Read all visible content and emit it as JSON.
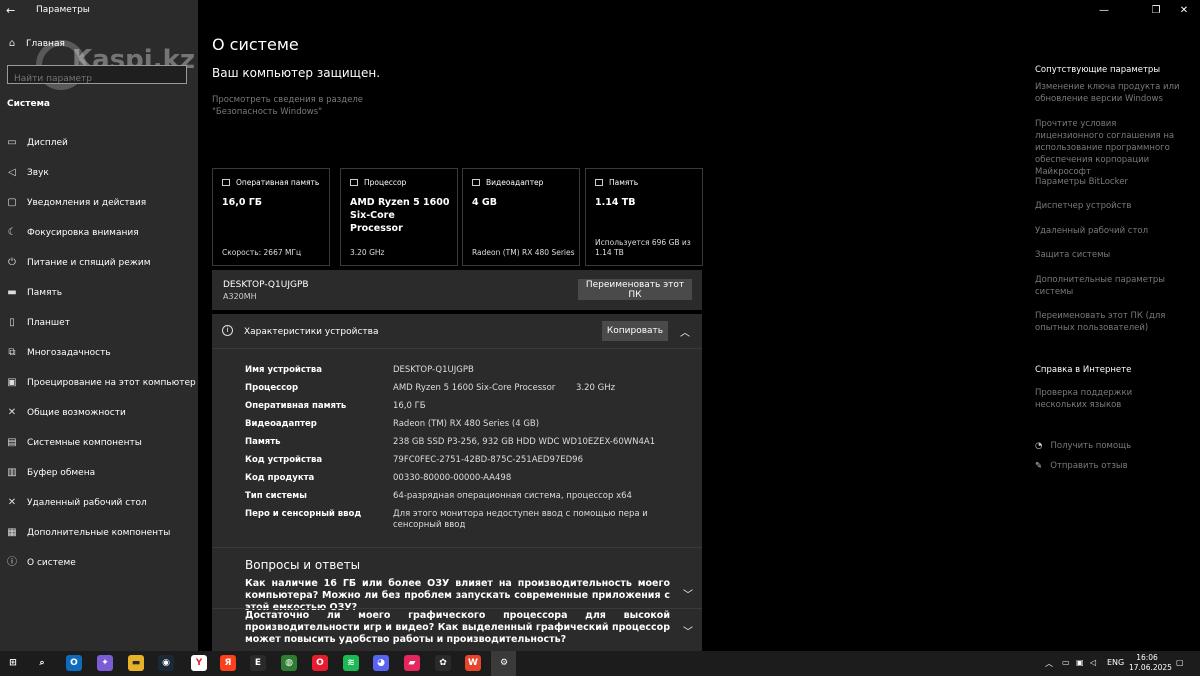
{
  "titlebar": {
    "app_title": "Параметры",
    "back": "←",
    "minimize": "—",
    "maximize": "❐",
    "close": "✕"
  },
  "watermark": "Kaspi.kz",
  "sidebar": {
    "home": "Главная",
    "search_placeholder": "Найти параметр",
    "section": "Система",
    "items": [
      {
        "label": "Дисплей",
        "icon": "display-icon",
        "glyph": "▭"
      },
      {
        "label": "Звук",
        "icon": "speaker-icon",
        "glyph": "◁"
      },
      {
        "label": "Уведомления и действия",
        "icon": "notification-icon",
        "glyph": "▢"
      },
      {
        "label": "Фокусировка внимания",
        "icon": "moon-icon",
        "glyph": "☾"
      },
      {
        "label": "Питание и спящий режим",
        "icon": "power-icon",
        "glyph": "⏻"
      },
      {
        "label": "Память",
        "icon": "storage-icon",
        "glyph": "▬"
      },
      {
        "label": "Планшет",
        "icon": "tablet-icon",
        "glyph": "▯"
      },
      {
        "label": "Многозадачность",
        "icon": "multitask-icon",
        "glyph": "⧉"
      },
      {
        "label": "Проецирование на этот компьютер",
        "icon": "project-icon",
        "glyph": "▣"
      },
      {
        "label": "Общие возможности",
        "icon": "shared-icon",
        "glyph": "✕"
      },
      {
        "label": "Системные компоненты",
        "icon": "components-icon",
        "glyph": "▤"
      },
      {
        "label": "Буфер обмена",
        "icon": "clipboard-icon",
        "glyph": "▥"
      },
      {
        "label": "Удаленный рабочий стол",
        "icon": "remote-icon",
        "glyph": "✕"
      },
      {
        "label": "Дополнительные компоненты",
        "icon": "addons-icon",
        "glyph": "▦"
      },
      {
        "label": "О системе",
        "icon": "info-icon",
        "glyph": "ⓘ"
      }
    ]
  },
  "main": {
    "title": "О системе",
    "protected": "Ваш компьютер защищен.",
    "security_link": "Просмотреть сведения в разделе \"Безопасность Windows\"",
    "cards": [
      {
        "head": "Оперативная память",
        "value": "16,0 ГБ",
        "sub": "Скорость: 2667 МГц"
      },
      {
        "head": "Процессор",
        "value": "AMD Ryzen 5 1600 Six-Core Processor",
        "sub": "3.20 GHz"
      },
      {
        "head": "Видеоадаптер",
        "value": "4 GB",
        "sub": "Radeon (TM) RX 480 Series"
      },
      {
        "head": "Память",
        "value": "1.14 TB",
        "sub": "Используется 696 GB из 1.14 TB"
      }
    ],
    "pc_name": "DESKTOP-Q1UJGPB",
    "board": "A320MH",
    "rename_button": "Переименовать этот ПК",
    "specs_title": "Характеристики устройства",
    "copy_button": "Копировать",
    "specs": [
      {
        "key": "Имя устройства",
        "value": "DESKTOP-Q1UJGPB"
      },
      {
        "key": "Процессор",
        "value": "AMD Ryzen 5 1600 Six-Core Processor",
        "extra": "3.20 GHz"
      },
      {
        "key": "Оперативная память",
        "value": "16,0 ГБ"
      },
      {
        "key": "Видеоадаптер",
        "value": "Radeon (TM) RX 480 Series (4 GB)"
      },
      {
        "key": "Память",
        "value": "238 GB SSD P3-256, 932 GB HDD WDC WD10EZEX-60WN4A1"
      },
      {
        "key": "Код устройства",
        "value": "79FC0FEC-2751-42BD-875C-251AED97ED96"
      },
      {
        "key": "Код продукта",
        "value": "00330-80000-00000-AA498"
      },
      {
        "key": "Тип системы",
        "value": "64-разрядная операционная система, процессор x64"
      },
      {
        "key": "Перо и сенсорный ввод",
        "value": "Для этого монитора недоступен ввод с помощью пера и сенсорный ввод"
      }
    ],
    "qa_title": "Вопросы и ответы",
    "qa": [
      "Как наличие 16 ГБ или более ОЗУ влияет на производительность моего компьютера? Можно ли без проблем запускать современные приложения с этой емкостью ОЗУ?",
      "Достаточно ли моего графического процессора для высокой производительности игр и видео? Как выделенный графический процессор может повысить удобство работы и производительность?"
    ]
  },
  "right_panel": {
    "related_head": "Сопутствующие параметры",
    "related": [
      "Изменение ключа продукта или обновление версии Windows",
      "Прочтите условия лицензионного соглашения на использование программного обеспечения корпорации Майкрософт",
      "Параметры BitLocker",
      "Диспетчер устройств",
      "Удаленный рабочий стол",
      "Защита системы",
      "Дополнительные параметры системы",
      "Переименовать этот ПК (для опытных пользователей)"
    ],
    "web_head": "Справка в Интернете",
    "web_links": [
      "Проверка поддержки нескольких языков"
    ],
    "help": "Получить помощь",
    "feedback": "Отправить отзыв"
  },
  "taskbar": {
    "lang": "ENG",
    "time": "16:06",
    "date": "17.06.2025",
    "apps": [
      {
        "name": "start-icon",
        "glyph": "⊞",
        "color": "transparent"
      },
      {
        "name": "search-icon",
        "glyph": "⌕",
        "color": "transparent"
      },
      {
        "name": "outlook-icon",
        "glyph": "O",
        "color": "#0f6cbd"
      },
      {
        "name": "copilot-icon",
        "glyph": "✦",
        "color": "#7b5cd6"
      },
      {
        "name": "explorer-icon",
        "glyph": "▬",
        "color": "#e8b228"
      },
      {
        "name": "steam-icon",
        "glyph": "◉",
        "color": "#1b2838"
      },
      {
        "name": "yandex-browser-icon",
        "glyph": "Y",
        "color": "#ffffff"
      },
      {
        "name": "yandex-icon",
        "glyph": "Я",
        "color": "#fc3f1d"
      },
      {
        "name": "epic-games-icon",
        "glyph": "E",
        "color": "#2a2a2a"
      },
      {
        "name": "xbox-icon",
        "glyph": "◍",
        "color": "#2e7d32"
      },
      {
        "name": "opera-icon",
        "glyph": "O",
        "color": "#e81c2f"
      },
      {
        "name": "spotify-icon",
        "glyph": "≋",
        "color": "#1db954"
      },
      {
        "name": "discord-icon",
        "glyph": "◕",
        "color": "#5865f2"
      },
      {
        "name": "wps-icon",
        "glyph": "▰",
        "color": "#e8265e"
      },
      {
        "name": "chatgpt-icon",
        "glyph": "✿",
        "color": "#2a2a2a"
      },
      {
        "name": "wps-office-icon",
        "glyph": "W",
        "color": "#e5452b"
      },
      {
        "name": "settings-icon",
        "glyph": "⚙",
        "color": "transparent"
      }
    ]
  }
}
